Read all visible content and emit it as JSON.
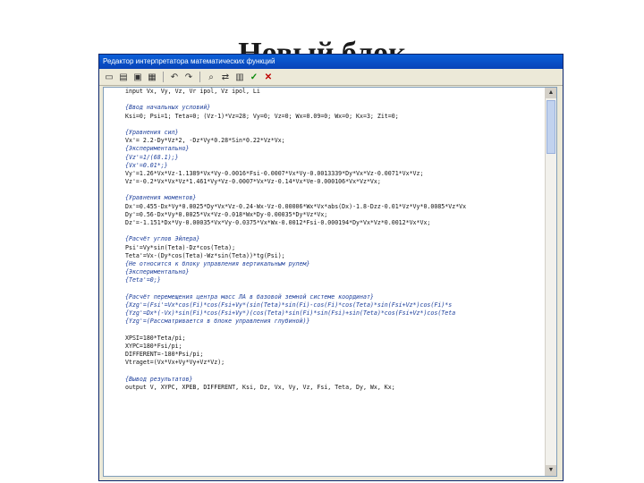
{
  "slide": {
    "title": "Новый блок"
  },
  "window": {
    "title": "Редактор интерпретатора математических функций"
  },
  "toolbar": {
    "icons": [
      "new-file-icon",
      "open-file-icon",
      "save-file-icon",
      "undo-icon",
      "redo-icon",
      "find-icon",
      "replace-icon",
      "run-icon",
      "check-icon",
      "close-icon"
    ]
  },
  "code_lines": [
    {
      "text": "input Vx, Vy, Vz, Vr ipol, Vz ipol, Li",
      "kind": "code"
    },
    {
      "text": "",
      "kind": "code"
    },
    {
      "text": "{Ввод начальных условий}",
      "kind": "cmt"
    },
    {
      "text": "Ksi=0; Psi=1; Teta=0; (Vz-1)*Vz=28; Vy=0; Vz=0; Wx=0.09=0; Wx=0; Kx=3; Zit=0;",
      "kind": "code"
    },
    {
      "text": "",
      "kind": "code"
    },
    {
      "text": "{Уравнения сил}",
      "kind": "cmt"
    },
    {
      "text": "Vx'= 2.2-Dy*Vz*2, -Dz*Vy*0.28*Sin*0.22*Vz*Vx;",
      "kind": "code"
    },
    {
      "text": "{Экспериментально}",
      "kind": "cmt"
    },
    {
      "text": "{Vz'=1/(68.1);}",
      "kind": "cmt"
    },
    {
      "text": "{Vx'=0.01*;}",
      "kind": "cmt"
    },
    {
      "text": "Vy'=1.26*Vx*Vz-1.1389*Vx*Vy-0.0016*Fsi-0.0007*Vx*Vy-0.0013339*Dy*Vx*Vz-0.0071*Vx*Vz;",
      "kind": "code"
    },
    {
      "text": "Vz'=-0.2*Vx*Vx*Vz*1.461*Vy*Vz-0.0007*Vx*Vz-0.14*Vx*Ve-0.000106*Vx*Vz*Vx;",
      "kind": "code"
    },
    {
      "text": "",
      "kind": "code"
    },
    {
      "text": "{Уравнения моментов}",
      "kind": "cmt"
    },
    {
      "text": "Dx'=0.455-Dx*Vy*0.0025*Dy*Vx*Vz-0.24-Wx-Vz-0.00006*Wx*Vx*abs(Dx)-1.8-Dzz-0.01*Vz*Vy*0.0085*Vz*Vx",
      "kind": "code"
    },
    {
      "text": "Dy'=0.56-Dx*Vy*0.0025*Vx*Vz-0.018*Wx*Dy-0.00035*Dy*Vz*Vx;",
      "kind": "code"
    },
    {
      "text": "Dz'=-1.151*Dx*Vy-0.00035*Vx*Vy-0.0375*Vx*Wx-0.0012*Fsi-0.000194*Dy*Vx*Vz*0.0012*Vx*Vx;",
      "kind": "code"
    },
    {
      "text": "",
      "kind": "code"
    },
    {
      "text": "{Расчёт углов Эйлера}",
      "kind": "cmt"
    },
    {
      "text": "Psi'=Vy*sin(Teta)-Dz*cos(Teta);",
      "kind": "code"
    },
    {
      "text": "Teta'=Vx-(Dy*cos(Teta)-Wz*sin(Teta))*tg(Psi);",
      "kind": "code"
    },
    {
      "text": "{Не относится к блоку управления вертикальным рулем}",
      "kind": "cmt"
    },
    {
      "text": "{Экспериментально}",
      "kind": "cmt"
    },
    {
      "text": "{Teta'=0;}",
      "kind": "cmt"
    },
    {
      "text": "",
      "kind": "code"
    },
    {
      "text": "{Расчёт перемещения центра масс ЛА в базовой земной системе координат}",
      "kind": "cmt"
    },
    {
      "text": "{Xzg'=(Fsi'=Vx*cos(Fi)*cos(Fsi+Vy*(sin(Teta)*sin(Fi)-cos(Fi)*cos(Teta)*sin(Fsi+Vz*)cos(Fi)*s",
      "kind": "cmt"
    },
    {
      "text": "{Yzg'=Dx*(-Vx)*sin(Fi)*cos(Fsi+Vy*)(cos(Teta)*sin(Fi)*sin(Fsi)+sin(Teta)*cos(Fsi+Vz*)cos(Teta",
      "kind": "cmt"
    },
    {
      "text": "{Yzg'=(Рассматривается в блоке управления глубиной)}",
      "kind": "cmt"
    },
    {
      "text": "",
      "kind": "code"
    },
    {
      "text": "XPSI=180*Teta/pi;",
      "kind": "code"
    },
    {
      "text": "XYPC=180*Fsi/pi;",
      "kind": "code"
    },
    {
      "text": "DIFFERENT=-180*Psi/pi;",
      "kind": "code"
    },
    {
      "text": "Vtraget=(Vx*Vx+Vy*Vy+Vz*Vz);",
      "kind": "code"
    },
    {
      "text": "",
      "kind": "code"
    },
    {
      "text": "{Вывод результатов}",
      "kind": "cmt"
    },
    {
      "text": "output V, XYPC, XPEB, DIFFERENT, Ksi, Dz, Vx, Vy, Vz, Fsi, Teta, Dy, Wx, Kx;",
      "kind": "code"
    }
  ],
  "scrollbar": {
    "position": 0
  }
}
